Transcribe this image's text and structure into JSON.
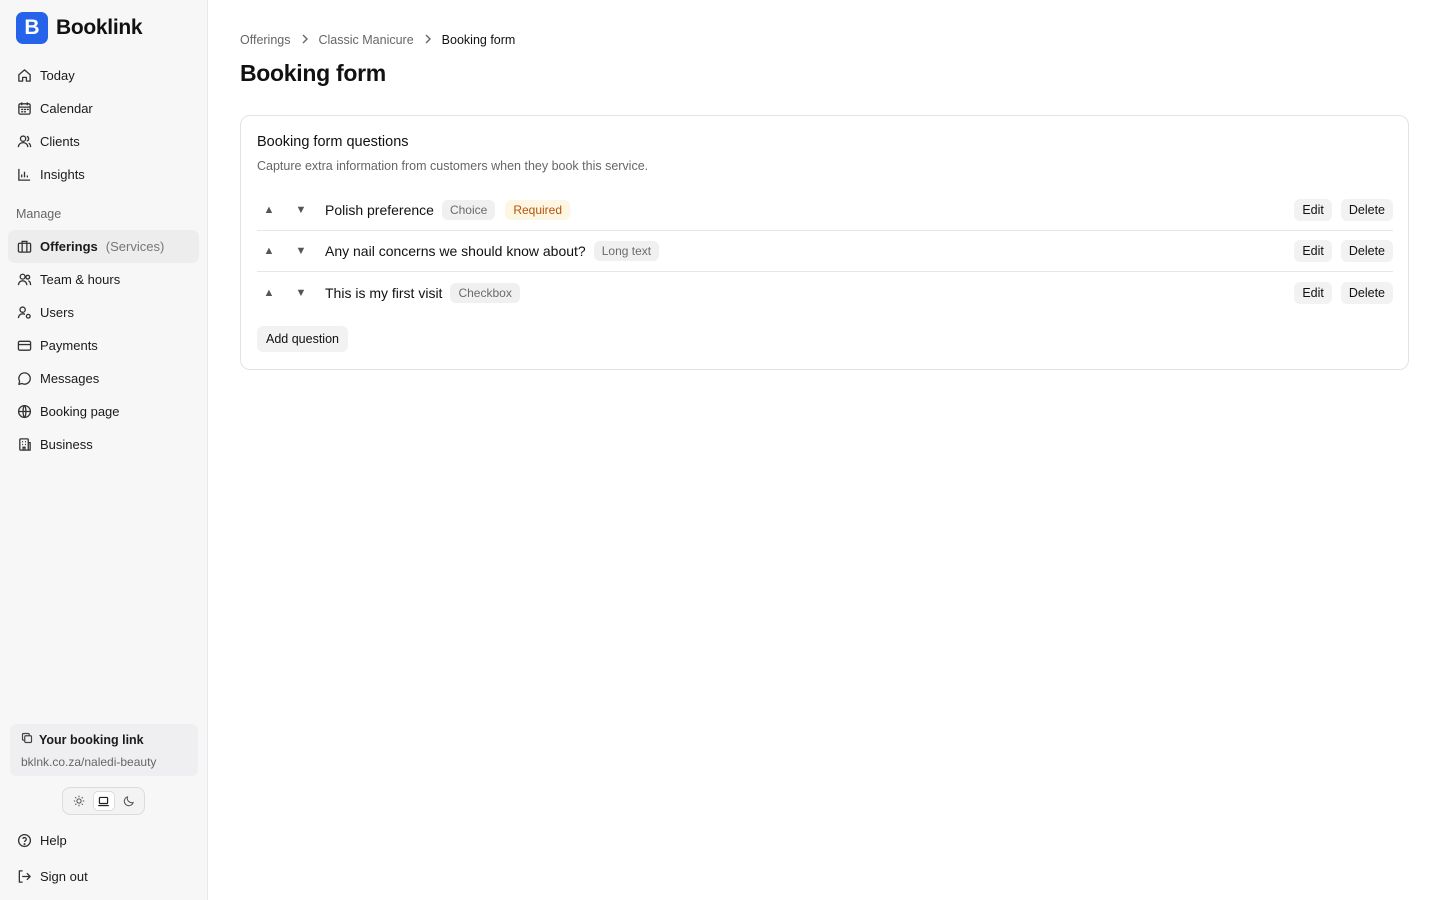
{
  "brand": {
    "logo_letter": "B",
    "name": "Booklink",
    "accent": "#2563eb"
  },
  "nav_primary": [
    {
      "label": "Today",
      "icon": "home-icon"
    },
    {
      "label": "Calendar",
      "icon": "calendar-icon"
    },
    {
      "label": "Clients",
      "icon": "users-icon"
    },
    {
      "label": "Insights",
      "icon": "chart-icon"
    }
  ],
  "manage": {
    "section_label": "Manage",
    "items": [
      {
        "label": "Offerings",
        "sublabel": "(Services)",
        "icon": "briefcase-icon",
        "active": true
      },
      {
        "label": "Team & hours",
        "icon": "team-icon"
      },
      {
        "label": "Users",
        "icon": "user-gear-icon"
      },
      {
        "label": "Payments",
        "icon": "credit-card-icon"
      },
      {
        "label": "Messages",
        "icon": "message-icon"
      },
      {
        "label": "Booking page",
        "icon": "globe-icon"
      },
      {
        "label": "Business",
        "icon": "building-icon"
      }
    ]
  },
  "booking_link": {
    "title": "Your booking link",
    "url": "bklnk.co.za/naledi-beauty",
    "icon": "copy-icon"
  },
  "theme": {
    "options": [
      "light",
      "system",
      "dark"
    ],
    "selected": "system"
  },
  "nav_bottom": [
    {
      "label": "Help",
      "icon": "help-icon"
    },
    {
      "label": "Sign out",
      "icon": "sign-out-icon"
    }
  ],
  "breadcrumb": [
    "Offerings",
    "Classic Manicure",
    "Booking form"
  ],
  "page_title": "Booking form",
  "card": {
    "title": "Booking form questions",
    "description": "Capture extra information from customers when they book this service.",
    "questions": [
      {
        "label": "Polish preference",
        "type": "Choice",
        "required": "Required"
      },
      {
        "label": "Any nail concerns we should know about?",
        "type": "Long text"
      },
      {
        "label": "This is my first visit",
        "type": "Checkbox"
      }
    ],
    "edit_label": "Edit",
    "delete_label": "Delete",
    "add_label": "Add question"
  },
  "colors": {
    "required_text": "#b45309",
    "required_bg": "#fdf6e3"
  }
}
